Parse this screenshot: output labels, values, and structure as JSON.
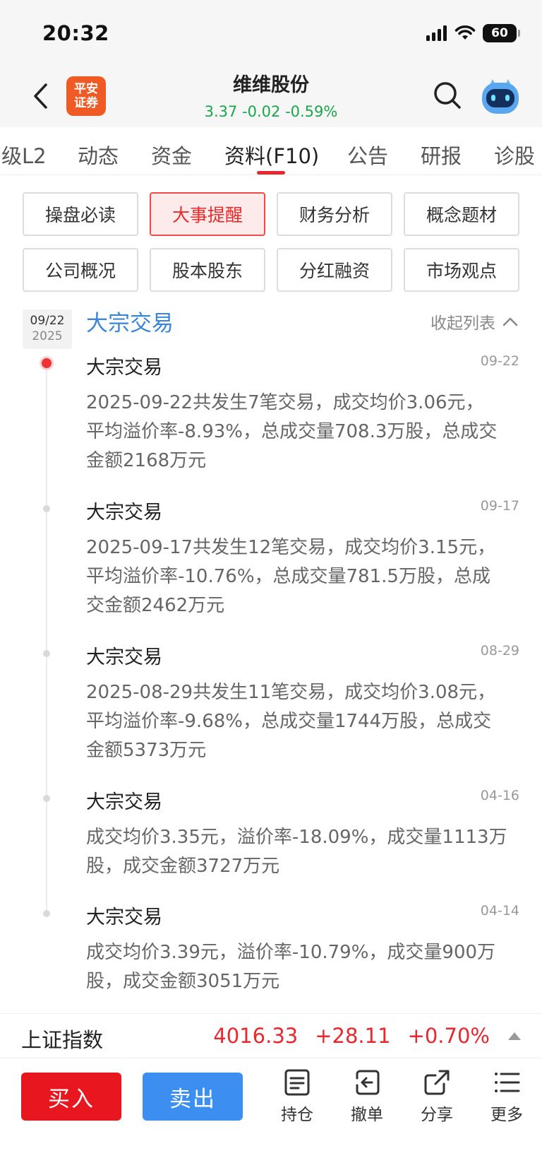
{
  "status_bar": {
    "time": "20:32",
    "battery": "60"
  },
  "header": {
    "broker_logo_line1": "平安",
    "broker_logo_line2": "证券",
    "stock_name": "维维股份",
    "quote": "3.37 -0.02 -0.59%",
    "quote_color": "#1aa64b"
  },
  "tabs": [
    {
      "label": "级L2"
    },
    {
      "label": "动态"
    },
    {
      "label": "资金"
    },
    {
      "label": "资料(F10)",
      "active": true
    },
    {
      "label": "公告"
    },
    {
      "label": "研报"
    },
    {
      "label": "诊股"
    }
  ],
  "categories": [
    {
      "label": "操盘必读"
    },
    {
      "label": "大事提醒",
      "active": true
    },
    {
      "label": "财务分析"
    },
    {
      "label": "概念题材"
    },
    {
      "label": "公司概况"
    },
    {
      "label": "股本股东"
    },
    {
      "label": "分红融资"
    },
    {
      "label": "市场观点"
    }
  ],
  "section": {
    "date_md": "09/22",
    "date_year": "2025",
    "title": "大宗交易",
    "collapse_label": "收起列表"
  },
  "events": [
    {
      "title": "大宗交易",
      "date": "09-22",
      "body_lines": [
        "2025-09-22共发生7笔交易，成交均价3.06元，",
        "平均溢价率-8.93%，总成交量708.3万股，总成交",
        "金额2168万元"
      ]
    },
    {
      "title": "大宗交易",
      "date": "09-17",
      "body_lines": [
        "2025-09-17共发生12笔交易，成交均价3.15元，",
        "平均溢价率-10.76%，总成交量781.5万股，总成",
        "交金额2462万元"
      ]
    },
    {
      "title": "大宗交易",
      "date": "08-29",
      "body_lines": [
        "2025-08-29共发生11笔交易，成交均价3.08元，",
        "平均溢价率-9.68%，总成交量1744万股，总成交",
        "金额5373万元"
      ]
    },
    {
      "title": "大宗交易",
      "date": "04-16",
      "body_lines": [
        "成交均价3.35元，溢价率-18.09%，成交量1113万",
        "股，成交金额3727万元"
      ]
    },
    {
      "title": "大宗交易",
      "date": "04-14",
      "body_lines": [
        "成交均价3.39元，溢价率-10.79%，成交量900万",
        "股，成交金额3051万元"
      ]
    }
  ],
  "index_bar": {
    "name": "上证指数",
    "value": "4016.33",
    "change": "+28.11",
    "pct": "+0.70%",
    "color": "#e8272f"
  },
  "bottom_bar": {
    "buy": "买入",
    "sell": "卖出",
    "tools": [
      {
        "label": "持仓"
      },
      {
        "label": "撤单"
      },
      {
        "label": "分享"
      },
      {
        "label": "更多"
      }
    ]
  }
}
